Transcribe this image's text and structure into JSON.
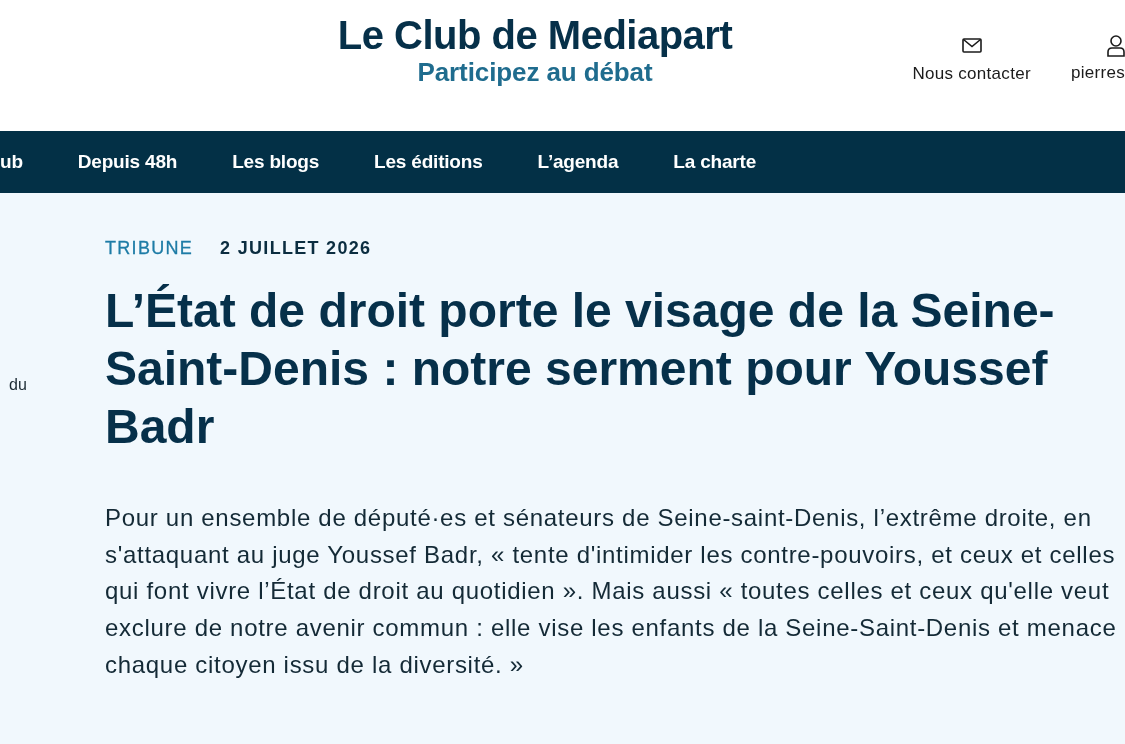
{
  "header": {
    "title": "Le Club de Mediapart",
    "tagline": "Participez au débat",
    "actions": [
      {
        "kind": "mail",
        "label": "Nous contacter"
      },
      {
        "kind": "user",
        "label": "pierres"
      }
    ]
  },
  "nav": {
    "items": [
      {
        "label": "ub"
      },
      {
        "label": "Depuis 48h"
      },
      {
        "label": "Les blogs"
      },
      {
        "label": "Les éditions"
      },
      {
        "label": "L’agenda"
      },
      {
        "label": "La charte"
      }
    ]
  },
  "sidebar": {
    "text": "du"
  },
  "article": {
    "category": "TRIBUNE",
    "date": "2 JUILLET 2026",
    "title": "L’État de droit porte le visage de la Seine-Saint-Denis : notre serment pour Youssef Badr",
    "lede": "Pour un ensemble de député·es et sénateurs de Seine-saint-Denis, l’extrême droite, en s'attaquant au juge Youssef Badr, « tente d'intimider les contre-pouvoirs, et ceux et celles qui font vivre l’État de droit au quotidien ». Mais aussi « toutes celles et ceux qu'elle veut exclure de notre avenir commun : elle vise les enfants de la Seine-Saint-Denis et menace chaque citoyen issu de la diversité. »"
  }
}
